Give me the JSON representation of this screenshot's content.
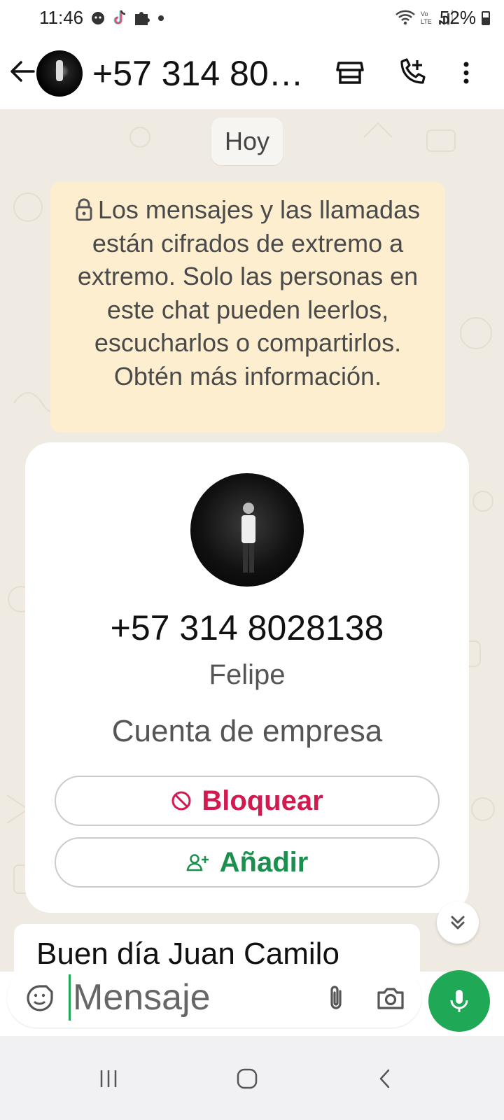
{
  "status_bar": {
    "time": "11:46",
    "battery": "52%",
    "icons_left": [
      "android-icon",
      "tiktok-icon",
      "puzzle-icon",
      "dot-icon"
    ],
    "icons_right": [
      "wifi-icon",
      "volte-icon",
      "signal-icon",
      "battery-icon"
    ]
  },
  "header": {
    "title": "+57 314 80…",
    "icons": [
      "back-arrow-icon",
      "store-icon",
      "add-call-icon",
      "more-vert-icon"
    ]
  },
  "chat": {
    "date_chip": "Hoy",
    "encryption_notice": "Los mensajes y las llamadas están cifrados de extremo a extremo. Solo las personas en este chat pueden leerlos, escucharlos o compartirlos. Obtén más información.",
    "contact_card": {
      "phone": "+57 314 8028138",
      "name": "Felipe",
      "account_type": "Cuenta de empresa",
      "block_label": "Bloquear",
      "add_label": "Añadir"
    },
    "message_preview": "Buen día Juan Camilo"
  },
  "input": {
    "placeholder": "Mensaje"
  },
  "colors": {
    "accent": "#1fa855",
    "block_red": "#d11a4f",
    "add_green": "#1a8f4e",
    "chat_bg": "#efeae2",
    "notice_bg": "#fdeecf"
  }
}
